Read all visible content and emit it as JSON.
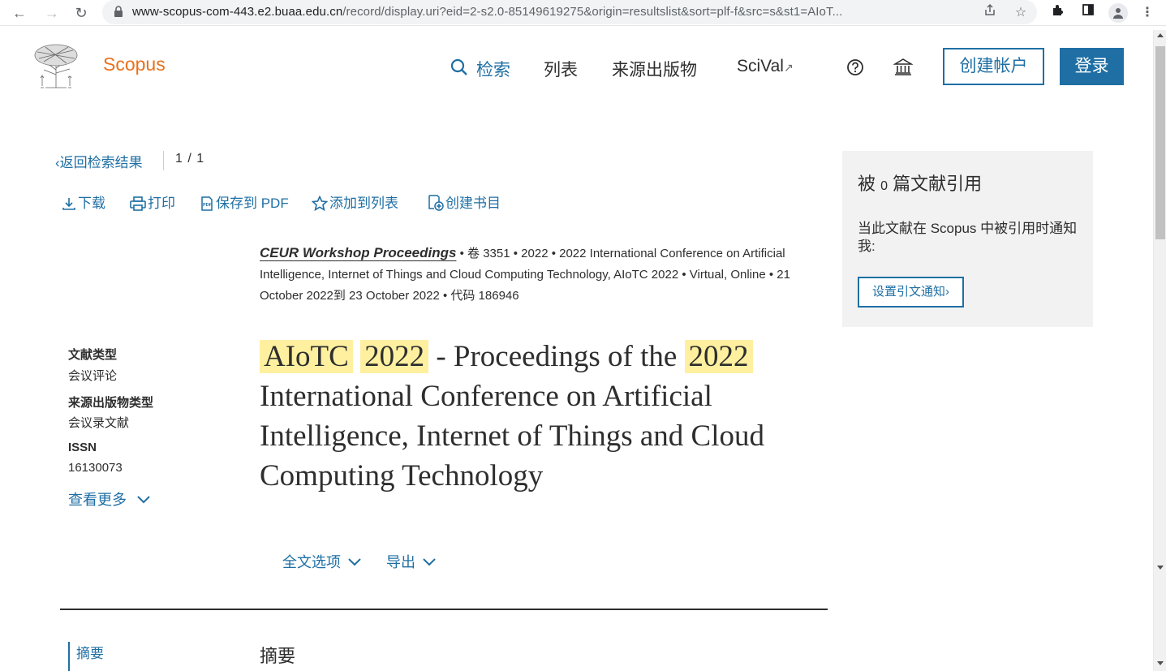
{
  "browser": {
    "url_host": "www-scopus-com-443.e2.buaa.edu.cn",
    "url_path": "/record/display.uri?eid=2-s2.0-85149619275&origin=resultslist&sort=plf-f&src=s&st1=AIoT..."
  },
  "header": {
    "brand": "Scopus",
    "nav": {
      "search": "检索",
      "lists": "列表",
      "sources": "来源出版物",
      "scival": "SciVal",
      "scival_arrow": "↗"
    },
    "create_account": "创建帐户",
    "login": "登录"
  },
  "record_nav": {
    "back": "返回检索结果",
    "pager": "1 / 1"
  },
  "toolbar": {
    "download": "下载",
    "print": "打印",
    "save_pdf": "保存到 PDF",
    "add_list": "添加到列表",
    "create_bib": "创建书目"
  },
  "source": {
    "journal": "CEUR Workshop Proceedings",
    "rest": " • 卷 3351 • 2022 • 2022 International Conference on Artificial Intelligence, Internet of Things and Cloud Computing Technology, AIoTC 2022 • Virtual, Online • 21 October 2022到 23 October 2022 • 代码 186946"
  },
  "meta": {
    "doc_type_label": "文献类型",
    "doc_type": "会议评论",
    "source_type_label": "来源出版物类型",
    "source_type": "会议录文献",
    "issn_label": "ISSN",
    "issn": "16130073",
    "see_more": "查看更多"
  },
  "title": {
    "hl1": "AIoTC",
    "hl2": "2022",
    "mid": " - Proceedings of the ",
    "hl3": "2022",
    "rest": " International Conference on Artificial Intelligence, Internet of Things and Cloud Computing Technology"
  },
  "options": {
    "fulltext": "全文选项",
    "export": "导出"
  },
  "abstract": {
    "side_label": "摘要",
    "heading": "摘要"
  },
  "citations": {
    "prefix": "被",
    "count": "0",
    "suffix": "篇文献引用",
    "desc": "当此文献在 Scopus 中被引用时通知我:",
    "button": "设置引文通知"
  },
  "colors": {
    "accent": "#1f6fa4",
    "brand": "#e9711c",
    "highlight": "#fff0a0"
  }
}
